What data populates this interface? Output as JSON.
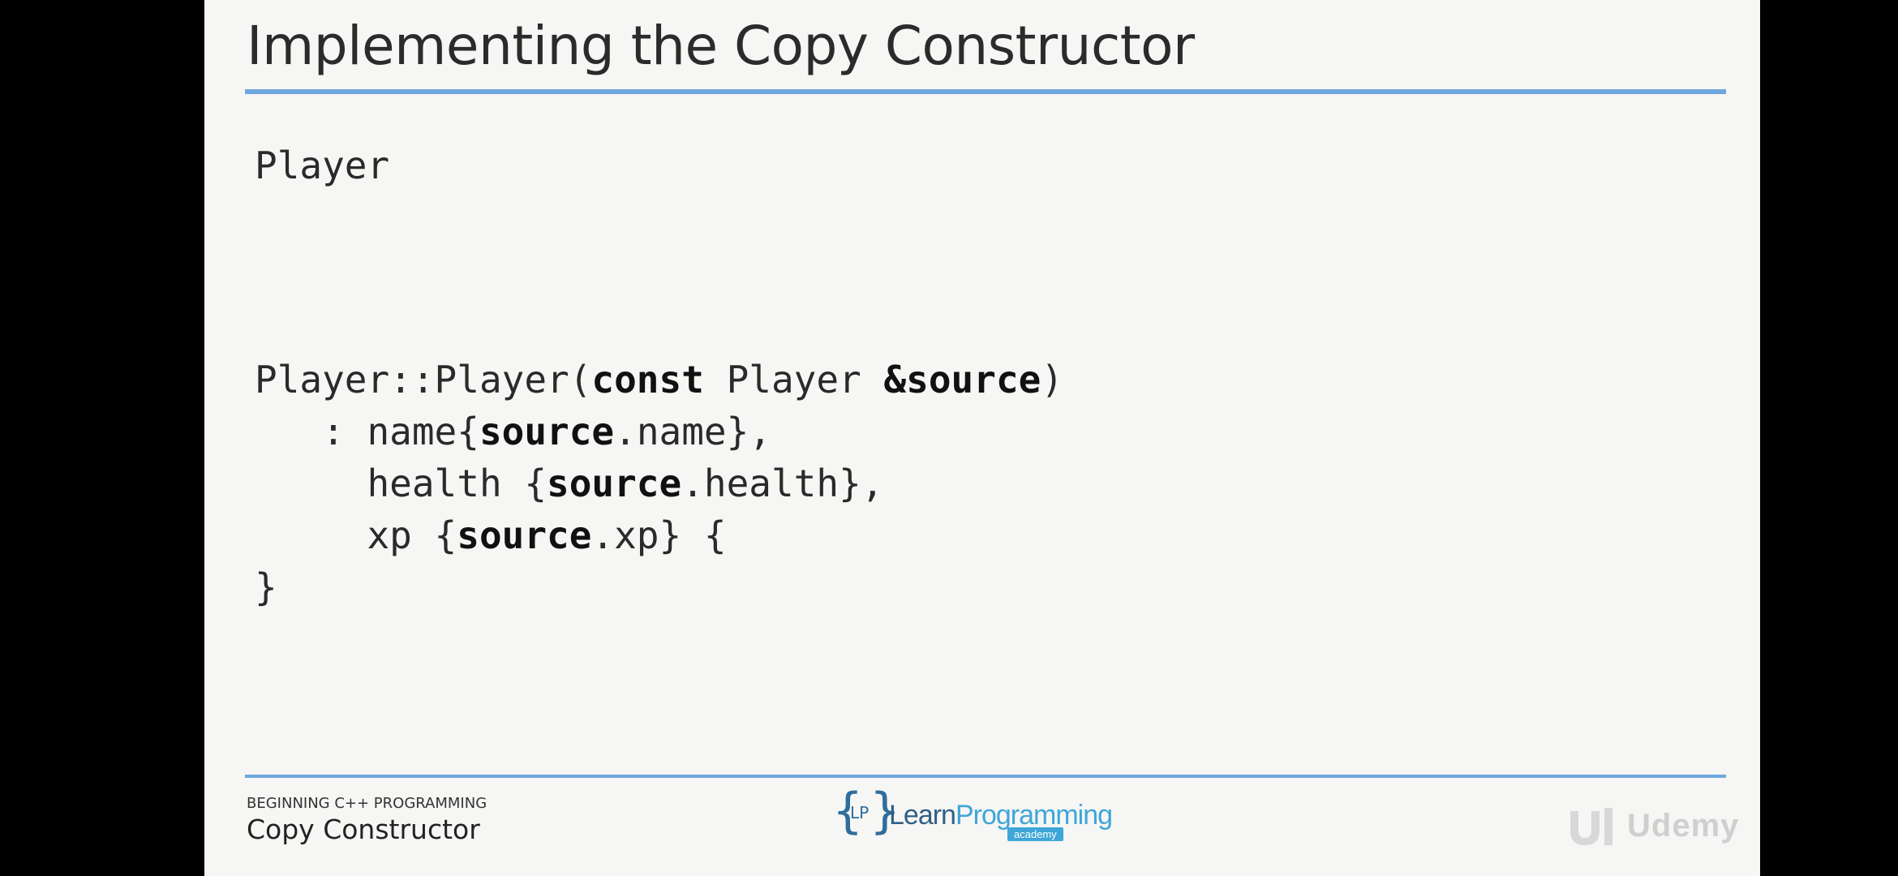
{
  "slide": {
    "title": "Implementing the Copy Constructor",
    "code_player": "Player",
    "code": {
      "l1_a": "Player::Player(",
      "l1_b": "const",
      "l1_c": " Player ",
      "l1_d": "&source",
      "l1_e": ")",
      "l2_a": "   : name{",
      "l2_b": "source",
      "l2_c": ".name},",
      "l3_a": "     health {",
      "l3_b": "source",
      "l3_c": ".health},",
      "l4_a": "     xp {",
      "l4_b": "source",
      "l4_c": ".xp} {",
      "l5": "}"
    },
    "footer": {
      "course": "BEGINNING C++ PROGRAMMING",
      "topic": "Copy Constructor"
    },
    "logo": {
      "lp": "LP",
      "learn": "Learn",
      "programming": "Programming",
      "academy": "academy"
    },
    "watermark": "Udemy"
  },
  "colors": {
    "accent_rule": "#6ea7de",
    "slide_bg": "#f6f6f4",
    "frame_bg": "#000000"
  }
}
